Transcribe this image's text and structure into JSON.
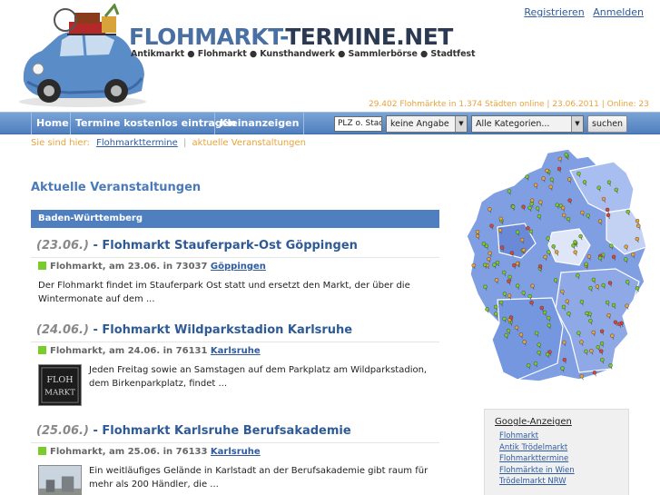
{
  "header": {
    "logo_main": "FLOHMARKT-",
    "logo_main2": "TERMINE.NET",
    "logo_sub": "Antikmarkt ● Flohmarkt ● Kunsthandwerk ● Sammlerbörse ● Stadtfest",
    "register_link": "Registrieren",
    "login_link": "Anmelden",
    "stats": "29.402 Flohmärkte in 1.374 Städten online | 23.06.2011 | Online: 23"
  },
  "nav": {
    "home": "Home",
    "free_dates": "Termine kostenlos eintragen",
    "classifieds": "Kleinanzeigen",
    "plz_placeholder": "PLZ o. Stadt",
    "radius_select": "keine Angabe",
    "category_select": "Alle Kategorien...",
    "search_button": "suchen"
  },
  "breadcrumb": {
    "prefix": "Sie sind hier:",
    "link": "Flohmarkttermine",
    "sep": "|",
    "current": "aktuelle Veranstaltungen"
  },
  "page_title": "Aktuelle Veranstaltungen",
  "region": "Baden-Württemberg",
  "events": [
    {
      "date": "(23.06.)",
      "title": "- Flohmarkt Stauferpark-Ost Göppingen",
      "meta": "Flohmarkt, am 23.06. in 73037",
      "city": "Göppingen",
      "desc": "Der Flohmarkt findet im Stauferpark Ost statt und ersetzt den Markt, der über die Wintermonate auf dem ..."
    },
    {
      "date": "(24.06.)",
      "title": "- Flohmarkt Wildparkstadion Karlsruhe",
      "meta": "Flohmarkt, am 24.06. in 76131",
      "city": "Karlsruhe",
      "desc": " Jeden Freitag sowie an Samstagen auf dem Parkplatz am Wildparkstadion, dem Birkenparkplatz, findet ...",
      "thumb_text": "FLOH MARKT"
    },
    {
      "date": "(25.06.)",
      "title": "- Flohmarkt Karlsruhe Berufsakademie",
      "meta": "Flohmarkt, am 25.06. in 76133",
      "city": "Karlsruhe",
      "desc": "Ein weitläufiges Gelände in Karlstadt an der Berufsakademie gibt raum für mehr als 200 Händler, die ..."
    }
  ],
  "ads": {
    "title": "Google-Anzeigen",
    "links": [
      "Flohmarkt",
      "Antik Trödelmarkt",
      "Flohmarkttermine",
      "Flohmärkte in Wien",
      "Trödelmarkt NRW"
    ]
  },
  "colors": {
    "nav_blue": "#4f7fbf",
    "title_blue": "#2e5a95",
    "accent_orange": "#e8a33a",
    "status_green": "#7acc2a"
  }
}
